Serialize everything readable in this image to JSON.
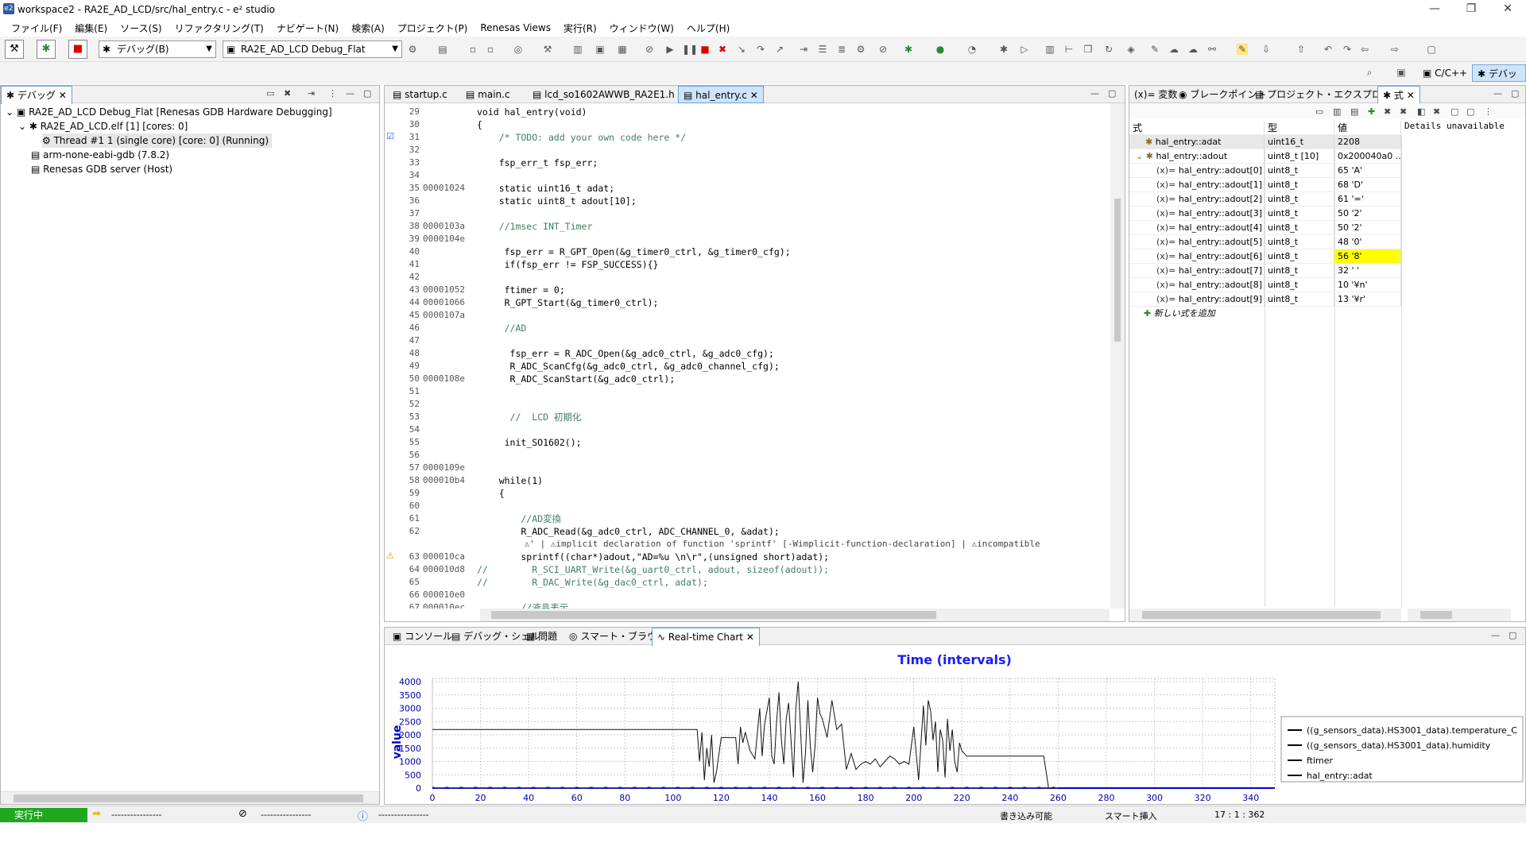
{
  "window": {
    "title": "workspace2 - RA2E_AD_LCD/src/hal_entry.c - e² studio",
    "app_icon": "e2"
  },
  "menu": [
    "ファイル(F)",
    "編集(E)",
    "ソース(S)",
    "リファクタリング(T)",
    "ナビゲート(N)",
    "検索(A)",
    "プロジェクト(P)",
    "Renesas Views",
    "実行(R)",
    "ウィンドウ(W)",
    "ヘルプ(H)"
  ],
  "toolbar": {
    "debug_combo": "デバッグ(B)",
    "config_combo": "RA2E_AD_LCD Debug_Flat"
  },
  "perspectives": {
    "cpp": "C/C++",
    "debug": "デバッグ"
  },
  "debug_view": {
    "tab": "デバッグ",
    "items": [
      "RA2E_AD_LCD Debug_Flat [Renesas GDB Hardware Debugging]",
      "RA2E_AD_LCD.elf [1] [cores: 0]",
      "Thread #1 1 (single core) [core: 0] (Running)",
      "arm-none-eabi-gdb (7.8.2)",
      "Renesas GDB server (Host)"
    ]
  },
  "editor": {
    "tabs": [
      "startup.c",
      "main.c",
      "lcd_so1602AWWB_RA2E1.h",
      "hal_entry.c"
    ],
    "lines": [
      {
        "n": "29",
        "a": "",
        "c": "void hal_entry(void)"
      },
      {
        "n": "30",
        "a": "",
        "c": "{"
      },
      {
        "n": "31",
        "a": "",
        "c": "    /* TODO: add your own code here */"
      },
      {
        "n": "32",
        "a": "",
        "c": ""
      },
      {
        "n": "33",
        "a": "",
        "c": "    fsp_err_t fsp_err;"
      },
      {
        "n": "34",
        "a": "",
        "c": ""
      },
      {
        "n": "35",
        "a": "00001024",
        "c": "    static uint16_t adat;"
      },
      {
        "n": "36",
        "a": "",
        "c": "    static uint8_t adout[10];"
      },
      {
        "n": "37",
        "a": "",
        "c": ""
      },
      {
        "n": "38",
        "a": "0000103a",
        "c": "    //1msec INT_Timer"
      },
      {
        "n": "39",
        "a": "0000104e",
        "c": ""
      },
      {
        "n": "40",
        "a": "",
        "c": "     fsp_err = R_GPT_Open(&g_timer0_ctrl, &g_timer0_cfg);"
      },
      {
        "n": "41",
        "a": "",
        "c": "     if(fsp_err != FSP_SUCCESS){}"
      },
      {
        "n": "42",
        "a": "",
        "c": ""
      },
      {
        "n": "43",
        "a": "00001052",
        "c": "     ftimer = 0;"
      },
      {
        "n": "44",
        "a": "00001066",
        "c": "     R_GPT_Start(&g_timer0_ctrl);"
      },
      {
        "n": "45",
        "a": "0000107a",
        "c": ""
      },
      {
        "n": "46",
        "a": "",
        "c": "     //AD"
      },
      {
        "n": "47",
        "a": "",
        "c": ""
      },
      {
        "n": "48",
        "a": "",
        "c": "      fsp_err = R_ADC_Open(&g_adc0_ctrl, &g_adc0_cfg);"
      },
      {
        "n": "49",
        "a": "",
        "c": "      R_ADC_ScanCfg(&g_adc0_ctrl, &g_adc0_channel_cfg);"
      },
      {
        "n": "50",
        "a": "0000108e",
        "c": "      R_ADC_ScanStart(&g_adc0_ctrl);"
      },
      {
        "n": "51",
        "a": "",
        "c": ""
      },
      {
        "n": "52",
        "a": "",
        "c": ""
      },
      {
        "n": "53",
        "a": "",
        "c": "      //  LCD 初期化"
      },
      {
        "n": "54",
        "a": "",
        "c": ""
      },
      {
        "n": "55",
        "a": "",
        "c": "     init_SO1602();"
      },
      {
        "n": "56",
        "a": "",
        "c": ""
      },
      {
        "n": "57",
        "a": "0000109e",
        "c": ""
      },
      {
        "n": "58",
        "a": "000010b4",
        "c": "    while(1)"
      },
      {
        "n": "59",
        "a": "",
        "c": "    {"
      },
      {
        "n": "60",
        "a": "",
        "c": ""
      },
      {
        "n": "61",
        "a": "",
        "c": "        //AD変換"
      },
      {
        "n": "62",
        "a": "",
        "c": "        R_ADC_Read(&g_adc0_ctrl, ADC_CHANNEL_0, &adat);"
      },
      {
        "n": "",
        "a": "",
        "c": "         ⚠' | ⚠implicit declaration of function 'sprintf' [-Wimplicit-function-declaration] | ⚠incompatible"
      },
      {
        "n": "63",
        "a": "000010ca",
        "c": "        sprintf((char*)adout,\"AD=%u \\n\\r\",(unsigned short)adat);"
      },
      {
        "n": "64",
        "a": "000010d8",
        "c": "//        R_SCI_UART_Write(&g_uart0_ctrl, adout, sizeof(adout));"
      },
      {
        "n": "65",
        "a": "",
        "c": "//        R_DAC_Write(&g_dac0_ctrl, adat);"
      },
      {
        "n": "66",
        "a": "000010e0",
        "c": ""
      },
      {
        "n": "67",
        "a": "000010ec",
        "c": "        //液晶表示"
      }
    ]
  },
  "right_tabs": [
    "変数",
    "ブレークポイント",
    "プロジェクト・エクスプローラー",
    "式"
  ],
  "expressions": {
    "headers": [
      "式",
      "型",
      "値"
    ],
    "details": "Details unavailable",
    "rows": [
      {
        "name": "hal_entry::adat",
        "type": "uint16_t",
        "value": "2208",
        "level": 0
      },
      {
        "name": "hal_entry::adout",
        "type": "uint8_t [10]",
        "value": "0x200040a0 ...",
        "level": 0
      },
      {
        "name": "hal_entry::adout[0]",
        "type": "uint8_t",
        "value": "65 'A'",
        "level": 1
      },
      {
        "name": "hal_entry::adout[1]",
        "type": "uint8_t",
        "value": "68 'D'",
        "level": 1
      },
      {
        "name": "hal_entry::adout[2]",
        "type": "uint8_t",
        "value": "61 '='",
        "level": 1
      },
      {
        "name": "hal_entry::adout[3]",
        "type": "uint8_t",
        "value": "50 '2'",
        "level": 1
      },
      {
        "name": "hal_entry::adout[4]",
        "type": "uint8_t",
        "value": "50 '2'",
        "level": 1
      },
      {
        "name": "hal_entry::adout[5]",
        "type": "uint8_t",
        "value": "48 '0'",
        "level": 1
      },
      {
        "name": "hal_entry::adout[6]",
        "type": "uint8_t",
        "value": "56 '8'",
        "level": 1,
        "highlight": "#ffff00"
      },
      {
        "name": "hal_entry::adout[7]",
        "type": "uint8_t",
        "value": "32 ' '",
        "level": 1
      },
      {
        "name": "hal_entry::adout[8]",
        "type": "uint8_t",
        "value": "10 '¥n'",
        "level": 1
      },
      {
        "name": "hal_entry::adout[9]",
        "type": "uint8_t",
        "value": "13 '¥r'",
        "level": 1
      }
    ],
    "add_new": "新しい式を追加"
  },
  "bottom_tabs": [
    "コンソール",
    "デバッグ・シェル",
    "問題",
    "スマート・ブラウザー",
    "Real-time Chart"
  ],
  "chart_data": {
    "type": "line",
    "title": "Time (intervals)",
    "xlabel": "",
    "ylabel": "value",
    "xlim": [
      0,
      350
    ],
    "ylim": [
      0,
      4000
    ],
    "xticks": [
      0,
      20,
      40,
      60,
      80,
      100,
      120,
      140,
      160,
      180,
      200,
      220,
      240,
      260,
      280,
      300,
      320,
      340
    ],
    "yticks": [
      0,
      500,
      1000,
      1500,
      2000,
      2500,
      3000,
      3500,
      4000
    ],
    "grid": true,
    "legend": "right",
    "series": [
      {
        "name": "((g_sensors_data).HS3001_data).temperature_C",
        "values": []
      },
      {
        "name": "((g_sensors_data).HS3001_data).humidity",
        "values": []
      },
      {
        "name": "ftimer",
        "values": []
      },
      {
        "name": "hal_entry::adat",
        "x": [
          0,
          110,
          111,
          112,
          113,
          114,
          115,
          116,
          117,
          118,
          120,
          122,
          124,
          125,
          126,
          127,
          128,
          129,
          130,
          132,
          134,
          136,
          137,
          138,
          140,
          141,
          142,
          143,
          144,
          145,
          146,
          147,
          148,
          149,
          150,
          151,
          152,
          153,
          154,
          155,
          156,
          157,
          158,
          159,
          160,
          161,
          162,
          164,
          166,
          168,
          170,
          172,
          174,
          176,
          178,
          180,
          182,
          184,
          186,
          188,
          190,
          192,
          194,
          196,
          198,
          200,
          202,
          204,
          205,
          206,
          207,
          208,
          209,
          210,
          211,
          212,
          213,
          214,
          215,
          216,
          217,
          218,
          219,
          220,
          222,
          224,
          226,
          228,
          230,
          232,
          234,
          236,
          238,
          240,
          242,
          244,
          246,
          248,
          250,
          252,
          254,
          256,
          258,
          260
        ],
        "values": [
          2200,
          2200,
          1000,
          2100,
          300,
          1500,
          800,
          2000,
          200,
          600,
          1900,
          1900,
          1900,
          1900,
          1900,
          900,
          2300,
          1700,
          2100,
          1400,
          1100,
          3000,
          1200,
          2400,
          3400,
          1200,
          900,
          2500,
          3600,
          1800,
          900,
          2600,
          3200,
          1800,
          400,
          3000,
          4000,
          2100,
          200,
          1300,
          3300,
          1600,
          600,
          1600,
          3400,
          2800,
          2600,
          1900,
          3300,
          2200,
          2400,
          700,
          1300,
          700,
          900,
          1000,
          900,
          1100,
          800,
          1000,
          1200,
          1100,
          900,
          1000,
          900,
          2300,
          300,
          3100,
          1600,
          3300,
          2900,
          1800,
          2500,
          600,
          2200,
          1800,
          400,
          2600,
          1400,
          2200,
          1000,
          600,
          1700,
          1400,
          1200,
          1200,
          1200,
          1200,
          1200,
          1200,
          1200,
          1200,
          1200,
          1200,
          1200,
          1200,
          1200,
          1200,
          1200,
          1200,
          1200,
          0,
          0,
          0
        ]
      }
    ]
  },
  "status": {
    "run": "実行中",
    "dash1": "----------------",
    "dash2": "----------------",
    "dash3": "----------------",
    "writable": "書き込み可能",
    "insert": "スマート挿入",
    "pos": "17 : 1 : 362"
  },
  "colors": {
    "chart_title": "#1a1aff",
    "axis": "#0000cc",
    "run_green": "#1fa81f"
  }
}
